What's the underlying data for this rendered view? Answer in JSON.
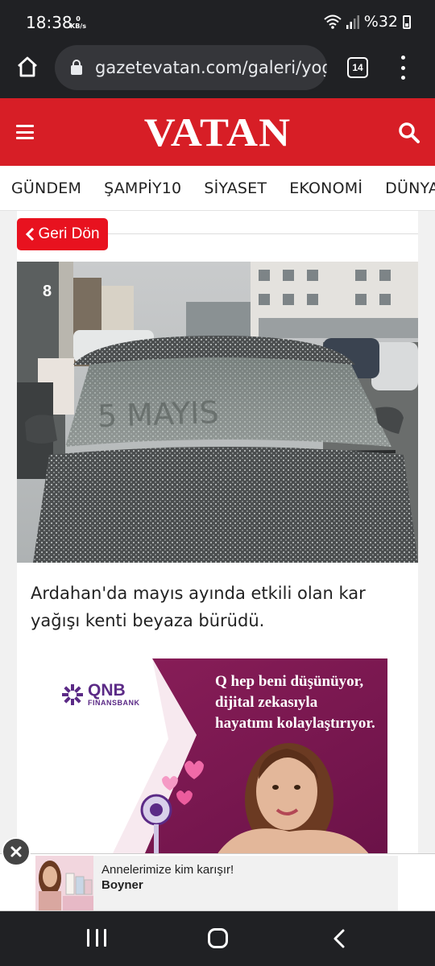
{
  "status_bar": {
    "time": "18:38",
    "net_speed_value": "0",
    "net_speed_unit": "KB/s",
    "battery": "%32"
  },
  "browser": {
    "url": "gazetevatan.com/galeri/yog",
    "tab_count": "14",
    "home_icon": "home-icon",
    "lock_icon": "lock-icon",
    "menu_icon": "more-vert-icon"
  },
  "site": {
    "logo": "VATAN",
    "brand_color": "#d71e26",
    "menu_icon": "hamburger-icon",
    "search_icon": "search-icon"
  },
  "nav": {
    "items": [
      {
        "label": "GÜNDEM"
      },
      {
        "label": "ŞAMPİY10"
      },
      {
        "label": "SİYASET"
      },
      {
        "label": "EKONOMİ"
      },
      {
        "label": "DÜNYA"
      }
    ]
  },
  "gallery": {
    "back_label": "Geri Dön",
    "photo_number": "8",
    "caption": "Ardahan'da mayıs ayında etkili olan kar yağışı kenti beyaza bürüdü."
  },
  "ad": {
    "bank_name": "QNB",
    "bank_sub": "FINANSBANK",
    "line1": "Q hep beni düşünüyor,",
    "line2": "dijital zekasıyla",
    "line3": "hayatımı kolaylaştırıyor."
  },
  "bottom_ad": {
    "title": "Annelerimize kim karışır!",
    "brand": "Boyner",
    "close_icon": "close-icon"
  },
  "system_nav": {
    "recent_icon": "recent-apps-icon",
    "home_icon": "home-circle-icon",
    "back_icon": "back-icon"
  }
}
